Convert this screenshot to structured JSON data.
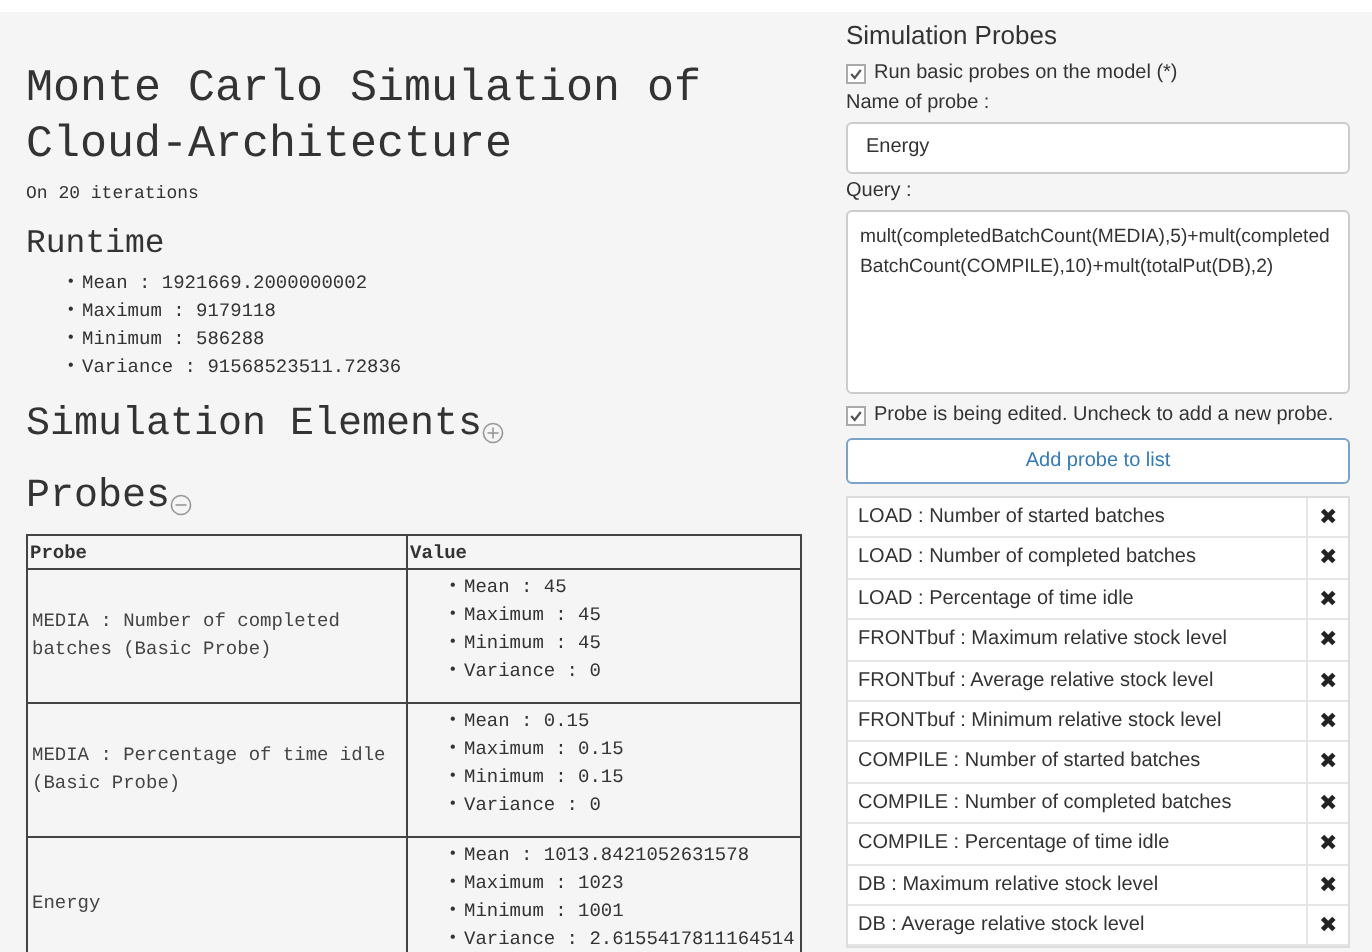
{
  "title": "Monte Carlo Simulation of Cloud-Architecture",
  "subtitle": "On 20 iterations",
  "runtime": {
    "heading": "Runtime",
    "stats": [
      {
        "bullet": "•",
        "text": "Mean : 1921669.2000000002"
      },
      {
        "bullet": "•",
        "text": "Maximum : 9179118"
      },
      {
        "bullet": "•",
        "text": "Minimum : 586288"
      },
      {
        "bullet": "•",
        "text": "Variance : 91568523511.72836"
      }
    ]
  },
  "elements_section": {
    "heading": "Simulation Elements",
    "expanded": false
  },
  "probes_section": {
    "heading": "Probes",
    "expanded": true
  },
  "table": {
    "columns": [
      "Probe",
      "Value"
    ],
    "rows": [
      {
        "probe": "MEDIA : Number of completed batches (Basic Probe)",
        "stats": [
          {
            "bullet": "•",
            "text": "Mean : 45"
          },
          {
            "bullet": "•",
            "text": "Maximum : 45"
          },
          {
            "bullet": "•",
            "text": "Minimum : 45"
          },
          {
            "bullet": "•",
            "text": "Variance : 0"
          }
        ]
      },
      {
        "probe": "MEDIA : Percentage of time idle (Basic Probe)",
        "stats": [
          {
            "bullet": "•",
            "text": "Mean : 0.15"
          },
          {
            "bullet": "•",
            "text": "Maximum : 0.15"
          },
          {
            "bullet": "•",
            "text": "Minimum : 0.15"
          },
          {
            "bullet": "•",
            "text": "Variance : 0"
          }
        ]
      },
      {
        "probe": "Energy",
        "stats": [
          {
            "bullet": "•",
            "text": "Mean : 1013.8421052631578"
          },
          {
            "bullet": "•",
            "text": "Maximum : 1023"
          },
          {
            "bullet": "•",
            "text": "Minimum : 1001"
          },
          {
            "bullet": "•",
            "text": "Variance : 2.6155417811164514"
          }
        ]
      }
    ]
  },
  "panel": {
    "title": "Simulation Probes",
    "basic_probes": {
      "label": "Run basic probes on the model (*)",
      "checked": true
    },
    "name_label": "Name of probe :",
    "name_value": "Energy",
    "query_label": "Query :",
    "query_value": "mult(completedBatchCount(MEDIA),5)+mult(completedBatchCount(COMPILE),10)+mult(totalPut(DB),2)",
    "editing": {
      "label": "Probe is being edited. Uncheck to add a new probe.",
      "checked": true
    },
    "add_button": "Add probe to list",
    "probe_list": [
      {
        "label": "LOAD : Number of started batches",
        "remove": "✖"
      },
      {
        "label": "LOAD : Number of completed batches",
        "remove": "✖"
      },
      {
        "label": "LOAD : Percentage of time idle",
        "remove": "✖"
      },
      {
        "label": "FRONTbuf : Maximum relative stock level",
        "remove": "✖"
      },
      {
        "label": "FRONTbuf : Average relative stock level",
        "remove": "✖"
      },
      {
        "label": "FRONTbuf : Minimum relative stock level",
        "remove": "✖"
      },
      {
        "label": "COMPILE : Number of started batches",
        "remove": "✖"
      },
      {
        "label": "COMPILE : Number of completed batches",
        "remove": "✖"
      },
      {
        "label": "COMPILE : Percentage of time idle",
        "remove": "✖"
      },
      {
        "label": "DB : Maximum relative stock level",
        "remove": "✖"
      },
      {
        "label": "DB : Average relative stock level",
        "remove": "✖"
      }
    ]
  }
}
